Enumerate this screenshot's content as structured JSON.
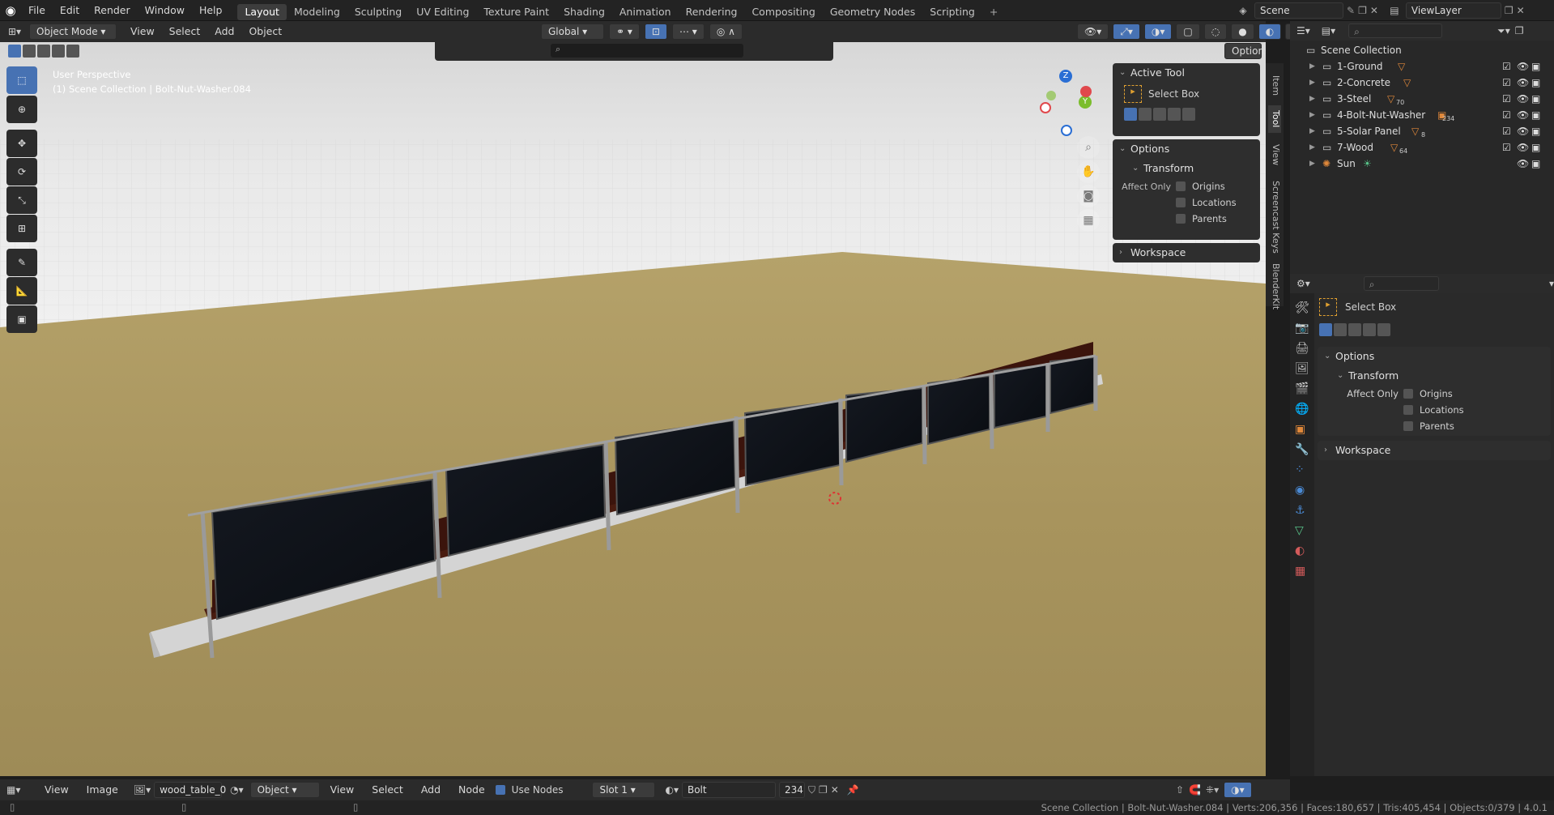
{
  "top_menu": [
    "File",
    "Edit",
    "Render",
    "Window",
    "Help"
  ],
  "workspaces": [
    "Layout",
    "Modeling",
    "Sculpting",
    "UV Editing",
    "Texture Paint",
    "Shading",
    "Animation",
    "Rendering",
    "Compositing",
    "Geometry Nodes",
    "Scripting"
  ],
  "active_workspace": "Layout",
  "scene_name": "Scene",
  "view_layer": "ViewLayer",
  "viewport": {
    "mode": "Object Mode",
    "menus": [
      "View",
      "Select",
      "Add",
      "Object"
    ],
    "transform_orientation": "Global",
    "options_label": "Options",
    "overlay_line1": "User Perspective",
    "overlay_line2": "(1) Scene Collection | Bolt-Nut-Washer.084",
    "gizmo_z": "Z",
    "gizmo_y": "Y"
  },
  "tool_panel": {
    "active_tool_title": "Active Tool",
    "tool_name": "Select Box",
    "options_title": "Options",
    "transform_title": "Transform",
    "affect_only": "Affect Only",
    "origins": "Origins",
    "locations": "Locations",
    "parents": "Parents",
    "workspace_title": "Workspace"
  },
  "side_tabs": [
    "Item",
    "Tool",
    "View",
    "Screencast Keys",
    "BlenderKit"
  ],
  "outliner": {
    "root": "Scene Collection",
    "items": [
      {
        "name": "1-Ground",
        "badge": ""
      },
      {
        "name": "2-Concrete",
        "badge": ""
      },
      {
        "name": "3-Steel",
        "badge": "70"
      },
      {
        "name": "4-Bolt-Nut-Washer",
        "badge": "234"
      },
      {
        "name": "5-Solar Panel",
        "badge": "8"
      },
      {
        "name": "7-Wood",
        "badge": "64"
      },
      {
        "name": "Sun",
        "badge": ""
      }
    ]
  },
  "properties": {
    "tool_name": "Select Box",
    "options_title": "Options",
    "transform_title": "Transform",
    "affect_only": "Affect Only",
    "origins": "Origins",
    "locations": "Locations",
    "parents": "Parents",
    "workspace_title": "Workspace"
  },
  "bottom_header": {
    "menus1": [
      "View",
      "Image"
    ],
    "image_name": "wood_table_0",
    "object_label": "Object",
    "menus2": [
      "View",
      "Select",
      "Add",
      "Node"
    ],
    "use_nodes": "Use Nodes",
    "slot": "Slot 1",
    "material": "Bolt",
    "user_count": "234"
  },
  "status_text": "Scene Collection | Bolt-Nut-Washer.084 | Verts:206,356 | Faces:180,657 | Tris:405,454 | Objects:0/379 | 4.0.1",
  "colors": {
    "accent": "#4772b3",
    "ground": "#a8955f",
    "panel": "#2e2e2e"
  }
}
